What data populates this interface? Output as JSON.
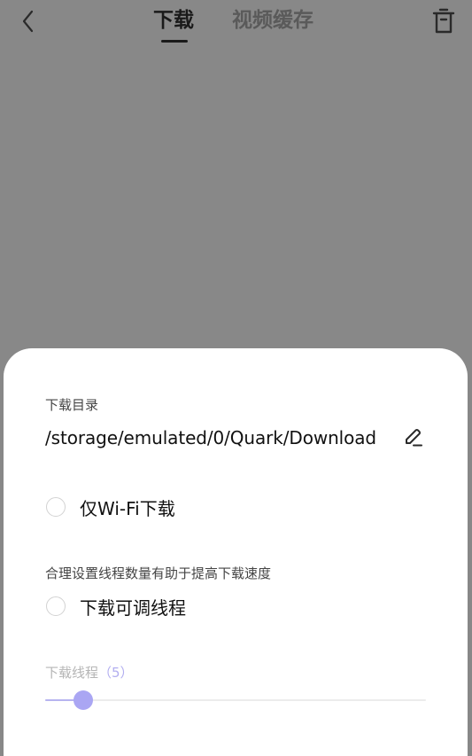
{
  "header": {
    "tabs": [
      {
        "label": "下载",
        "active": true
      },
      {
        "label": "视频缓存",
        "active": false
      }
    ],
    "back_icon": "chevron-left-icon",
    "trash_icon": "trash-icon"
  },
  "settings": {
    "dir_label": "下载目录",
    "dir_path": "/storage/emulated/0/Quark/Download",
    "edit_icon": "pencil-icon",
    "wifi_only_label": "仅Wi-Fi下载",
    "wifi_only_checked": false,
    "thread_hint": "合理设置线程数量有助于提高下载速度",
    "adjustable_threads_label": "下载可调线程",
    "adjustable_threads_checked": false,
    "threads_label": "下载线程",
    "threads_count": "（5）",
    "threads_value": 5,
    "threads_level": 0.1
  },
  "colors": {
    "overlay": "#888888",
    "slider_accent": "#aaa6f3",
    "slider_fill": "#b7b4f0",
    "sheet_bg": "#ffffff"
  }
}
